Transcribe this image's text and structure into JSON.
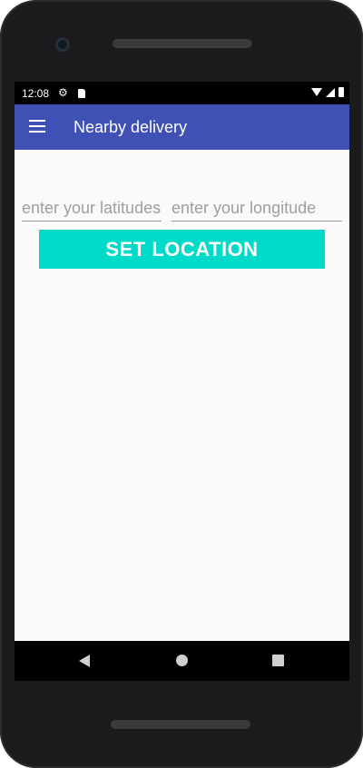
{
  "status_bar": {
    "time": "12:08",
    "icons": [
      "gear-icon",
      "sd-card-icon",
      "wifi-icon",
      "signal-icon",
      "battery-icon"
    ]
  },
  "app_bar": {
    "title": "Nearby delivery",
    "menu_icon": "hamburger-menu-icon",
    "color": "#3f51b5"
  },
  "form": {
    "latitude_placeholder": "enter your latitudes",
    "latitude_value": "",
    "longitude_placeholder": "enter your longitude",
    "longitude_value": "",
    "set_location_label": "SET LOCATION",
    "button_color": "#00dbc9"
  },
  "nav_bar": {
    "icons": [
      "back-icon",
      "home-icon",
      "recents-icon"
    ]
  }
}
